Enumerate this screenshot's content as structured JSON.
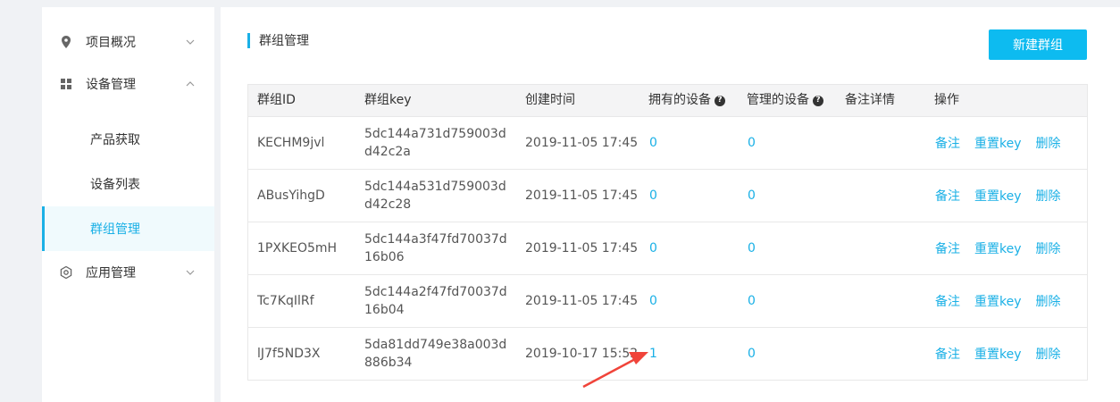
{
  "sidebar": {
    "items": [
      {
        "label": "项目概况",
        "icon": "location-pin-icon",
        "expanded": false
      },
      {
        "label": "设备管理",
        "icon": "grid-icon",
        "expanded": true
      },
      {
        "label": "应用管理",
        "icon": "gear-icon",
        "expanded": false
      }
    ],
    "sub_items": [
      {
        "label": "产品获取"
      },
      {
        "label": "设备列表"
      },
      {
        "label": "群组管理",
        "active": true
      }
    ]
  },
  "main": {
    "title": "群组管理",
    "new_button": "新建群组",
    "table": {
      "headers": [
        "群组ID",
        "群组key",
        "创建时间",
        "拥有的设备",
        "管理的设备",
        "备注详情",
        "操作"
      ],
      "rows": [
        {
          "id": "KECHM9jvl",
          "key": "5dc144a731d759003dd42c2a",
          "created": "2019-11-05 17:45",
          "owned": "0",
          "managed": "0",
          "note": ""
        },
        {
          "id": "ABusYihgD",
          "key": "5dc144a531d759003dd42c28",
          "created": "2019-11-05 17:45",
          "owned": "0",
          "managed": "0",
          "note": ""
        },
        {
          "id": "1PXKEO5mH",
          "key": "5dc144a3f47fd70037d16b06",
          "created": "2019-11-05 17:45",
          "owned": "0",
          "managed": "0",
          "note": ""
        },
        {
          "id": "Tc7KqIlRf",
          "key": "5dc144a2f47fd70037d16b04",
          "created": "2019-11-05 17:45",
          "owned": "0",
          "managed": "0",
          "note": ""
        },
        {
          "id": "lJ7f5ND3X",
          "key": "5da81dd749e38a003d886b34",
          "created": "2019-10-17 15:52",
          "owned": "1",
          "managed": "0",
          "note": ""
        }
      ],
      "actions": [
        "备注",
        "重置key",
        "删除"
      ]
    }
  },
  "colors": {
    "accent": "#1ab0e6",
    "button": "#0dbbf0",
    "arrow": "#f0443a"
  }
}
